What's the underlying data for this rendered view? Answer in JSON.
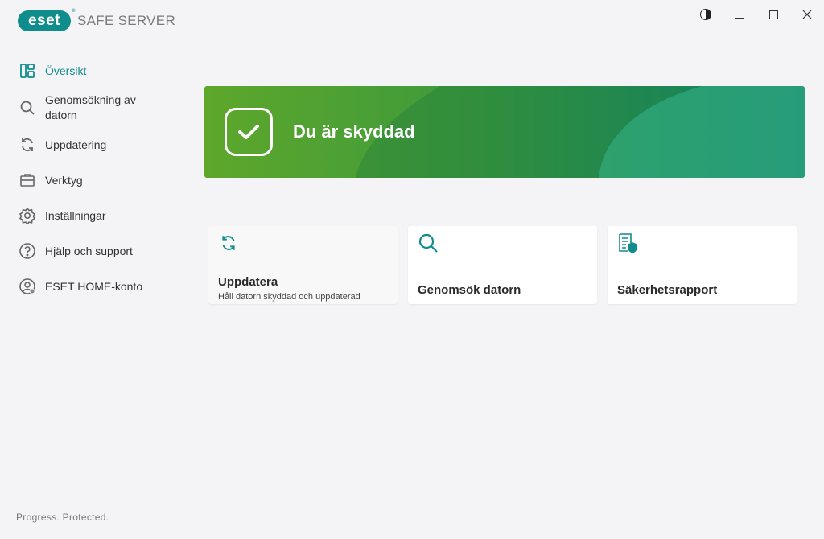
{
  "app": {
    "logo_text": "eset",
    "product_name": "SAFE SERVER"
  },
  "window_controls": {
    "contrast": "contrast-toggle",
    "minimize": "minimize",
    "maximize": "maximize",
    "close": "close"
  },
  "sidebar": {
    "items": [
      {
        "label": "Översikt",
        "icon": "overview-icon",
        "active": true
      },
      {
        "label": "Genomsökning av datorn",
        "icon": "search-icon"
      },
      {
        "label": "Uppdatering",
        "icon": "refresh-icon"
      },
      {
        "label": "Verktyg",
        "icon": "toolbox-icon"
      },
      {
        "label": "Inställningar",
        "icon": "gear-icon"
      },
      {
        "label": "Hjälp och support",
        "icon": "help-icon"
      },
      {
        "label": "ESET HOME-konto",
        "icon": "account-icon"
      }
    ],
    "footer": "Progress. Protected."
  },
  "status": {
    "title": "Du är skyddad",
    "icon": "checkmark-icon"
  },
  "cards": [
    {
      "title": "Uppdatera",
      "subtitle": "Håll datorn skyddad och uppdaterad",
      "icon": "refresh-icon"
    },
    {
      "title": "Genomsök datorn",
      "icon": "search-icon"
    },
    {
      "title": "Säkerhetsrapport",
      "icon": "security-report-icon"
    }
  ],
  "colors": {
    "accent": "#0f8c8c",
    "banner_start": "#5ea72b",
    "banner_end": "#13857a"
  }
}
